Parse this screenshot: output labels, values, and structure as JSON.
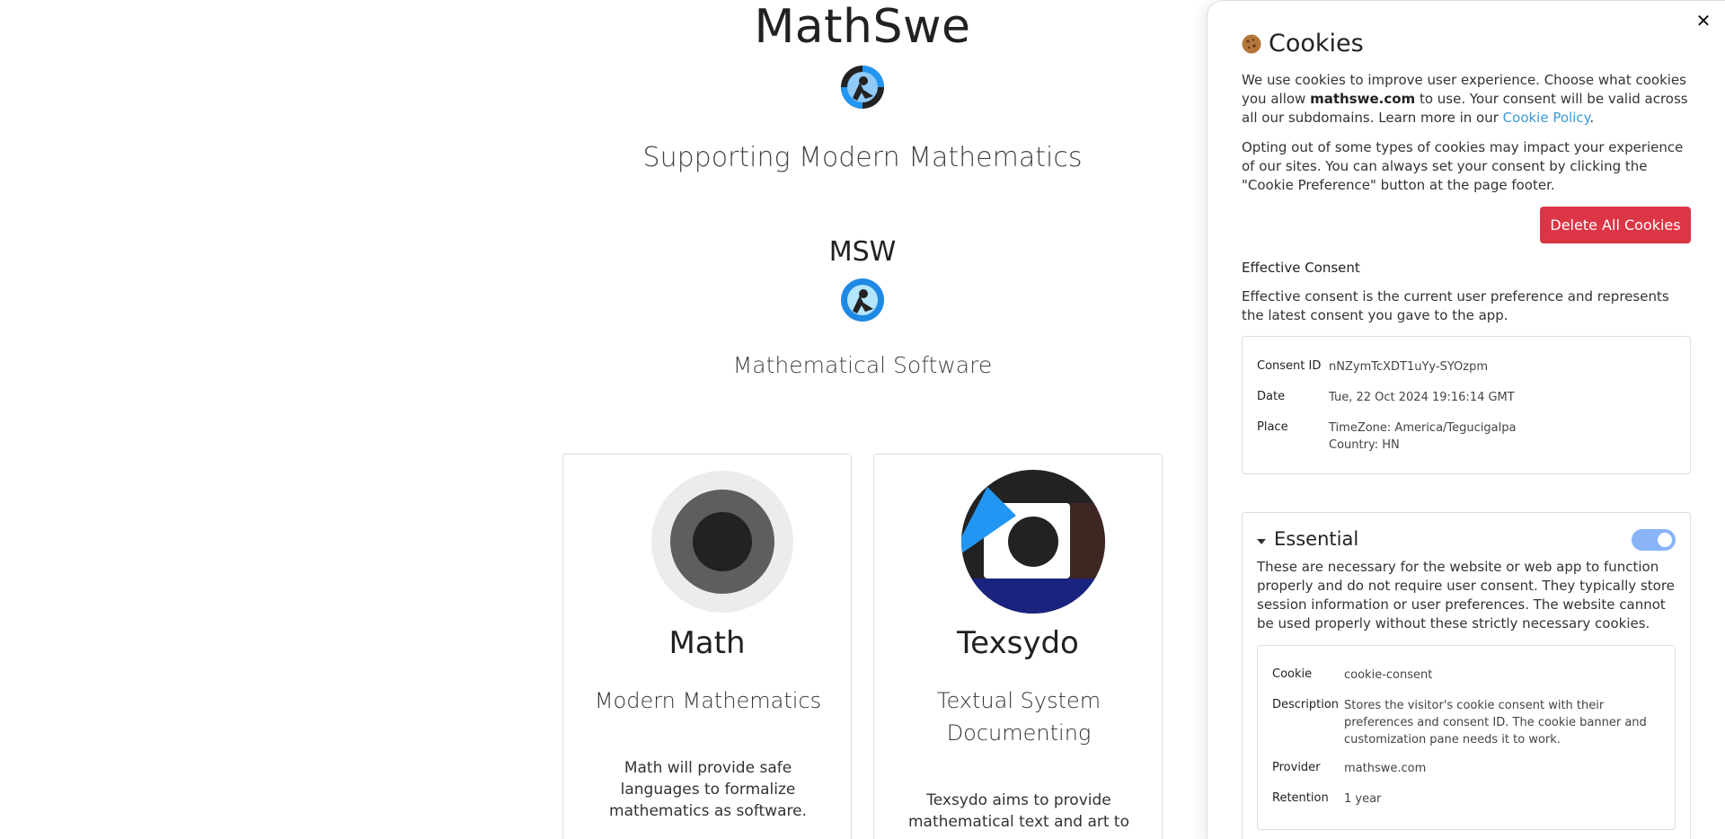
{
  "site": {
    "title": "MathSwe",
    "tagline": "Supporting Modern Mathematics",
    "msw_title": "MSW",
    "msw_subtitle": "Mathematical Software"
  },
  "cards": [
    {
      "title": "Math",
      "subtitle": "Modern Mathematics",
      "description": "Math will provide safe languages to formalize mathematics as software."
    },
    {
      "title": "Texsydo",
      "subtitle": "Textual System Documenting",
      "description": "Texsydo aims to provide mathematical text and art to"
    }
  ],
  "cookies": {
    "heading": "Cookies",
    "intro_part1": "We use cookies to improve user experience. Choose what cookies you allow ",
    "domain": "mathswe.com",
    "intro_part2": " to use. Your consent will be valid across all our subdomains. Learn more in our ",
    "policy_link": "Cookie Policy",
    "intro_end": ".",
    "opt_out_text": "Opting out of some types of cookies may impact your experience of our sites. You can always set your consent by clicking the \"Cookie Preference\" button at the page footer.",
    "delete_button": "Delete All Cookies",
    "effective_consent_label": "Effective Consent",
    "effective_consent_text": "Effective consent is the current user preference and represents the latest consent you gave to the app.",
    "consent": {
      "id_label": "Consent ID",
      "id_value": "nNZymTcXDT1uYy-SYOzpm",
      "date_label": "Date",
      "date_value": "Tue, 22 Oct 2024 19:16:14 GMT",
      "place_label": "Place",
      "place_timezone": "TimeZone: America/Tegucigalpa",
      "place_country": "Country: HN"
    },
    "essential": {
      "title": "Essential",
      "enabled": true,
      "description": "These are necessary for the website or web app to function properly and do not require user consent. They typically store session information or user preferences. The website cannot be used properly without these strictly necessary cookies.",
      "cookie_label": "Cookie",
      "cookie_value": "cookie-consent",
      "description_label": "Description",
      "description_value": "Stores the visitor's cookie consent with their preferences and consent ID. The cookie banner and customization pane needs it to work.",
      "provider_label": "Provider",
      "provider_value": "mathswe.com",
      "retention_label": "Retention",
      "retention_value": "1 year"
    }
  },
  "colors": {
    "accent_blue": "#2196f3",
    "delete_red": "#dc3545",
    "link_blue": "#3a9ad9",
    "toggle_on": "#8ab4f8"
  },
  "icons": {
    "close": "close-icon",
    "cookie": "cookie-icon",
    "caret": "caret-down-icon",
    "mathswe_logo": "mathswe-logo-icon",
    "msw_logo": "msw-logo-icon",
    "math_card": "math-logo-icon",
    "texsydo_card": "texsydo-logo-icon"
  }
}
